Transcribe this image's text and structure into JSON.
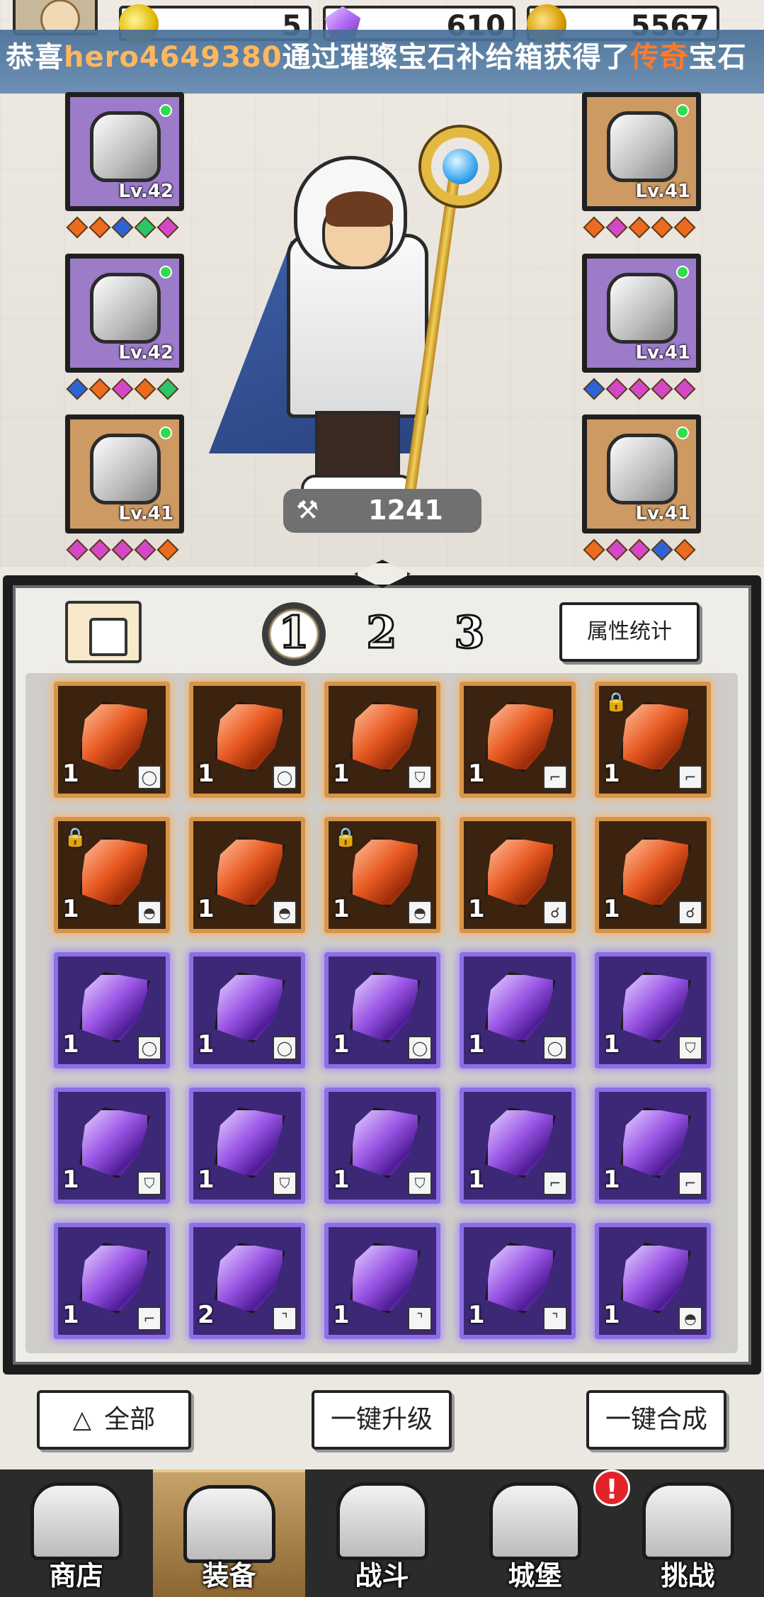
{
  "resources": {
    "energy": "5",
    "gems": "610",
    "coins": "5567"
  },
  "marquee": {
    "prefix": "恭喜",
    "user": "hero4649380",
    "middle": "通过璀璨宝石补给箱获得了",
    "rarity": "传奇",
    "suffix": "宝石"
  },
  "equipment": {
    "left": [
      {
        "name": "helmet",
        "level": "Lv.42",
        "rarity": "purple",
        "icon": "hood-icon",
        "sockets": [
          "o",
          "o",
          "b",
          "g",
          "p"
        ]
      },
      {
        "name": "armor",
        "level": "Lv.42",
        "rarity": "purple",
        "icon": "cape-icon",
        "sockets": [
          "b",
          "o",
          "p",
          "o",
          "g"
        ]
      },
      {
        "name": "boots",
        "level": "Lv.41",
        "rarity": "orange",
        "icon": "boot-icon",
        "sockets": [
          "p",
          "p",
          "p",
          "p",
          "o"
        ]
      }
    ],
    "right": [
      {
        "name": "gloves",
        "level": "Lv.41",
        "rarity": "orange",
        "icon": "bracer-icon",
        "sockets": [
          "o",
          "p",
          "o",
          "o",
          "o"
        ]
      },
      {
        "name": "ring",
        "level": "Lv.41",
        "rarity": "purple",
        "icon": "ring-icon",
        "sockets": [
          "b",
          "p",
          "p",
          "p",
          "p"
        ]
      },
      {
        "name": "necklace",
        "level": "Lv.41",
        "rarity": "orange",
        "icon": "necklace-icon",
        "sockets": [
          "o",
          "p",
          "p",
          "b",
          "o"
        ]
      }
    ]
  },
  "hero": {
    "power": "1241",
    "power_icon": "hammer-icon"
  },
  "panel": {
    "tabs": [
      "1",
      "2",
      "3"
    ],
    "active_tab": "1",
    "attr_button": "属性统计"
  },
  "gems": [
    {
      "color": "orange",
      "qty": "1",
      "slot": "ring",
      "locked": false
    },
    {
      "color": "orange",
      "qty": "1",
      "slot": "ring",
      "locked": false
    },
    {
      "color": "orange",
      "qty": "1",
      "slot": "armor",
      "locked": false
    },
    {
      "color": "orange",
      "qty": "1",
      "slot": "boots",
      "locked": false
    },
    {
      "color": "orange",
      "qty": "1",
      "slot": "boots",
      "locked": true
    },
    {
      "color": "orange",
      "qty": "1",
      "slot": "helmet",
      "locked": true
    },
    {
      "color": "orange",
      "qty": "1",
      "slot": "helmet",
      "locked": false
    },
    {
      "color": "orange",
      "qty": "1",
      "slot": "helmet",
      "locked": true
    },
    {
      "color": "orange",
      "qty": "1",
      "slot": "necklace",
      "locked": false
    },
    {
      "color": "orange",
      "qty": "1",
      "slot": "necklace",
      "locked": false
    },
    {
      "color": "purple",
      "qty": "1",
      "slot": "ring",
      "locked": false
    },
    {
      "color": "purple",
      "qty": "1",
      "slot": "ring",
      "locked": false
    },
    {
      "color": "purple",
      "qty": "1",
      "slot": "ring",
      "locked": false
    },
    {
      "color": "purple",
      "qty": "1",
      "slot": "ring",
      "locked": false
    },
    {
      "color": "purple",
      "qty": "1",
      "slot": "armor",
      "locked": false
    },
    {
      "color": "purple",
      "qty": "1",
      "slot": "armor",
      "locked": false
    },
    {
      "color": "purple",
      "qty": "1",
      "slot": "armor",
      "locked": false
    },
    {
      "color": "purple",
      "qty": "1",
      "slot": "armor",
      "locked": false
    },
    {
      "color": "purple",
      "qty": "1",
      "slot": "boots",
      "locked": false
    },
    {
      "color": "purple",
      "qty": "1",
      "slot": "boots",
      "locked": false
    },
    {
      "color": "purple",
      "qty": "1",
      "slot": "boots",
      "locked": false
    },
    {
      "color": "purple",
      "qty": "2",
      "slot": "gloves",
      "locked": false
    },
    {
      "color": "purple",
      "qty": "1",
      "slot": "gloves",
      "locked": false
    },
    {
      "color": "purple",
      "qty": "1",
      "slot": "gloves",
      "locked": false
    },
    {
      "color": "purple",
      "qty": "1",
      "slot": "helmet",
      "locked": false
    }
  ],
  "actions": {
    "filter": "全部",
    "upgrade_all": "一键升级",
    "merge_all": "一键合成"
  },
  "nav": [
    {
      "label": "商店",
      "icon": "shop-icon",
      "active": false
    },
    {
      "label": "装备",
      "icon": "backpack-icon",
      "active": true
    },
    {
      "label": "战斗",
      "icon": "crossed-swords-icon",
      "active": false
    },
    {
      "label": "城堡",
      "icon": "castle-icon",
      "active": false,
      "alert": "!"
    },
    {
      "label": "挑战",
      "icon": "shield-icon",
      "active": false
    }
  ]
}
